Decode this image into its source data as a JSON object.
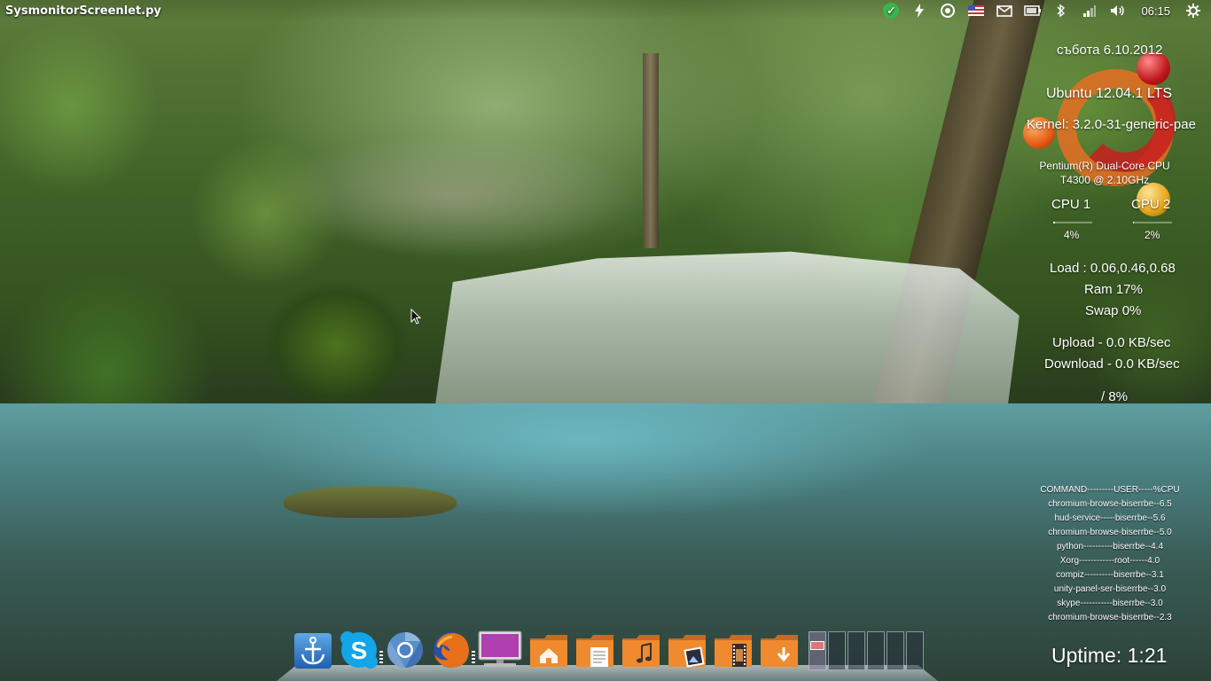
{
  "top_panel": {
    "app_title": "SysmonitorScreenlet.py",
    "indicators": {
      "update_icon": "checkmark-icon",
      "power_icon": "lightning-icon",
      "network_icon": "ring-icon",
      "keyboard_layout_icon": "us-flag-icon",
      "mail_icon": "envelope-icon",
      "battery_icon": "battery-icon",
      "bluetooth_icon": "bluetooth-icon",
      "signal_icon": "signal-bars-icon",
      "volume_icon": "speaker-icon",
      "session_icon": "gear-icon"
    },
    "clock": "06:15"
  },
  "sysmonitor": {
    "date": "събота  6.10.2012",
    "os": "Ubuntu 12.04.1 LTS",
    "kernel": "Kernel: 3.2.0-31-generic-pae",
    "cpu_model_line1": "Pentium(R) Dual-Core CPU",
    "cpu_model_line2": "T4300  @ 2.10GHz",
    "cpu1_label": "CPU 1",
    "cpu2_label": "CPU 2",
    "cpu1_percent": "4%",
    "cpu2_percent": "2%",
    "cpu1_value": 4,
    "cpu2_value": 2,
    "load": "Load : 0.06,0.46,0.68",
    "ram": "Ram 17%",
    "swap": "Swap 0%",
    "upload": "Upload - 0.0 KB/sec",
    "download": "Download - 0.0 KB/sec",
    "disk": "/ 8%",
    "uptime": "Uptime: 1:21",
    "accent_colors": {
      "ring": "#e16e23",
      "red": "#c0171c",
      "orange": "#e55b13",
      "yellow": "#e7a414"
    }
  },
  "process_table": {
    "header": "COMMAND---------USER-----%CPU",
    "rows": [
      "chromium-browse-biserrbe--6.5",
      "hud-service-----biserrbe--5.6",
      "chromium-browse-biserrbe--5.0",
      "python----------biserrbe--4.4",
      "Xorg------------root------4.0",
      "compiz----------biserrbe--3.1",
      "unity-panel-ser-biserrbe--3.0",
      "skype-----------biserrbe--3.0",
      "chromium-browse-biserrbe--2.3"
    ]
  },
  "dock": {
    "items": [
      {
        "name": "dock-anchor-launcher",
        "icon": "anchor-icon",
        "running": false
      },
      {
        "name": "dock-skype",
        "icon": "skype-icon",
        "running": false
      },
      {
        "name": "dock-chromium",
        "icon": "chromium-icon",
        "running": true
      },
      {
        "name": "dock-firefox",
        "icon": "firefox-icon",
        "running": false
      },
      {
        "name": "dock-display-settings",
        "icon": "monitor-icon",
        "running": true
      },
      {
        "name": "dock-home-folder",
        "icon": "home-folder-icon",
        "running": false
      },
      {
        "name": "dock-documents-folder",
        "icon": "documents-folder-icon",
        "running": false
      },
      {
        "name": "dock-music-folder",
        "icon": "music-folder-icon",
        "running": false
      },
      {
        "name": "dock-pictures-folder",
        "icon": "pictures-folder-icon",
        "running": false
      },
      {
        "name": "dock-videos-folder",
        "icon": "videos-folder-icon",
        "running": false
      },
      {
        "name": "dock-downloads-folder",
        "icon": "downloads-folder-icon",
        "running": false
      }
    ],
    "workspaces": 6,
    "active_workspace": 1
  }
}
